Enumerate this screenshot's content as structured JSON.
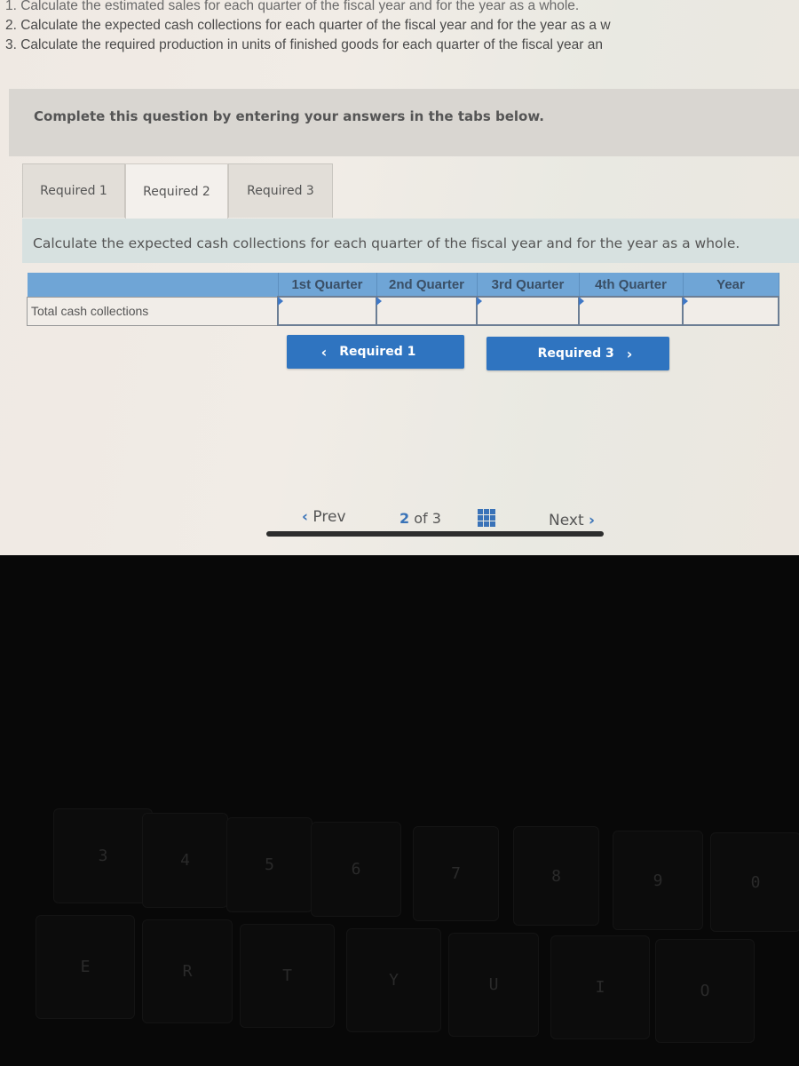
{
  "problem_lines": [
    "1. Calculate the estimated sales for each quarter of the fiscal year and for the year as a whole.",
    "2. Calculate the expected cash collections for each quarter of the fiscal year and for the year as a w",
    "3. Calculate the required production in units of finished goods for each quarter of the fiscal year an"
  ],
  "instruction": "Complete this question by entering your answers in the tabs below.",
  "tabs": [
    {
      "label": "Required 1",
      "active": false
    },
    {
      "label": "Required 2",
      "active": true
    },
    {
      "label": "Required 3",
      "active": false
    }
  ],
  "question": "Calculate the expected cash collections for each quarter of the fiscal year and for the year as a whole.",
  "table": {
    "columns": [
      "",
      "1st Quarter",
      "2nd Quarter",
      "3rd Quarter",
      "4th Quarter",
      "Year"
    ],
    "rows": [
      {
        "label": "Total cash collections",
        "values": [
          "",
          "",
          "",
          "",
          ""
        ]
      }
    ]
  },
  "nav": {
    "prev_required": "Required 1",
    "next_required": "Required 3",
    "prev_icon": "chevron-left-icon",
    "next_icon": "chevron-right-icon"
  },
  "pager": {
    "prev": "Prev",
    "current": "2",
    "of": "of",
    "total": "3",
    "next": "Next",
    "grid_icon": "grid-icon"
  },
  "keyboard": {
    "number_row": [
      {
        "top": "#",
        "bottom": "3"
      },
      {
        "top": "$",
        "bottom": "4"
      },
      {
        "top": "%",
        "bottom": "5"
      },
      {
        "top": "^",
        "bottom": "6"
      },
      {
        "top": "&",
        "bottom": "7"
      },
      {
        "top": "*",
        "bottom": "8"
      },
      {
        "top": "(",
        "bottom": "9"
      },
      {
        "top": ")",
        "bottom": "0"
      }
    ],
    "letter_row": [
      "E",
      "R",
      "T",
      "Y",
      "U",
      "I",
      "O"
    ]
  },
  "colors": {
    "accent": "#2f74c0",
    "table_header": "#6fa5d6",
    "question_panel": "#d7e1e0"
  }
}
